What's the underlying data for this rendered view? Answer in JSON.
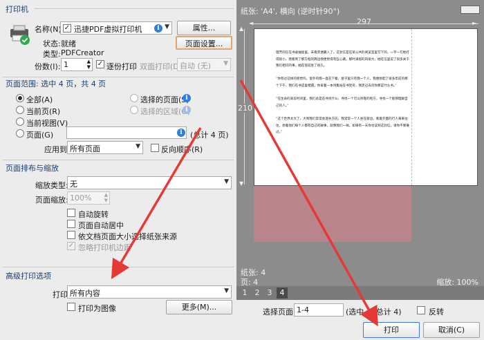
{
  "printer": {
    "section_title": "打印机",
    "name_label": "名称(N):",
    "name_value": "迅捷PDF虚拟打印机",
    "properties_btn": "属性...",
    "status_label": "状态:",
    "status_value": "就绪",
    "type_label": "类型:",
    "type_value": "PDFCreator",
    "page_setup_btn": "页面设置...",
    "copies_label": "份数(I):",
    "copies_value": "1",
    "collate_label": "逐份打印",
    "duplex_label": "双面打印(D):",
    "duplex_value": "自动 (无)"
  },
  "range": {
    "section_title": "页面范围: 选中 4 页，共 4 页",
    "all": "全部(A)",
    "current": "当前页(R)",
    "current_view": "当前视图(V)",
    "pages": "页面(G)",
    "selected_pages": "选择的页面(S)",
    "selected_area": "选择的区域(G)",
    "total": "(总计 4 页)",
    "apply_label": "应用到:",
    "apply_value": "所有页面",
    "reverse": "反向顺序(R)"
  },
  "layout": {
    "section_title": "页面排布与缩放",
    "scale_type_label": "缩放类型:",
    "scale_type_value": "无",
    "zoom_label": "页面缩放:",
    "zoom_value": "100%",
    "auto_rotate": "自动旋转",
    "auto_center": "页面自动居中",
    "choose_source": "依文档页面大小选择纸张来源",
    "ignore_margins": "忽略打印机边距"
  },
  "advanced": {
    "section_title": "高级打印选项",
    "print_label": "打印",
    "print_value": "所有内容",
    "print_as_image": "打印为图像",
    "more_btn": "更多(M)..."
  },
  "preview": {
    "paper_info": "纸张: 'A4', 横向 (逆时针90°)",
    "width_label": "297",
    "height_label": "210",
    "sheets": "纸张: 4",
    "pages": "页: 4",
    "zoom": "缩放: 100%",
    "page_tabs": [
      "1",
      "2",
      "3",
      "4"
    ],
    "doc_text": "理芳的信在书桌抽屉里。未看完便藏入了。这封信是在某公共的阅览室里写下的，一字一句地打得很小，我看到了那方框的两边我便觉得有些心跳。那时满窗的风很大，她在信里说了很多关于我们相识的事。她在窗前坐了很久。\n\n“你有过这样的感觉吗，窗外的雨一直在下着，屋子里只有我一个人，我便想起了很多年前的那个下午，我们在书店里相遇，你拿着一本诗集站在书架旁，我走过去问你那是什么书。”\n\n“在生命的某段时间里，我们总是在寻找什么，寻找一个可以停靠的地方，寻找一个能够理解自己的人。”\n\n“这个世界太大了，大到我们常常会迷失方向，我常常一个人坐在窗边，看着外面的行人来来往往，想着他们每个人都有自己的故事，就像我们一样。如果有一天你也读到这封信，请你不要难过。”"
  },
  "footer": {
    "select_pages_label": "选择页面:",
    "select_pages_value": "1-4",
    "selected_info": "(选中 4, 总计 4)",
    "reverse_label": "反转",
    "print_btn": "打印",
    "cancel_btn": "取消(C)"
  },
  "colors": {
    "accent": "#2e7de1",
    "arrow": "#e53935",
    "preview_bg": "#8c8c8c"
  }
}
